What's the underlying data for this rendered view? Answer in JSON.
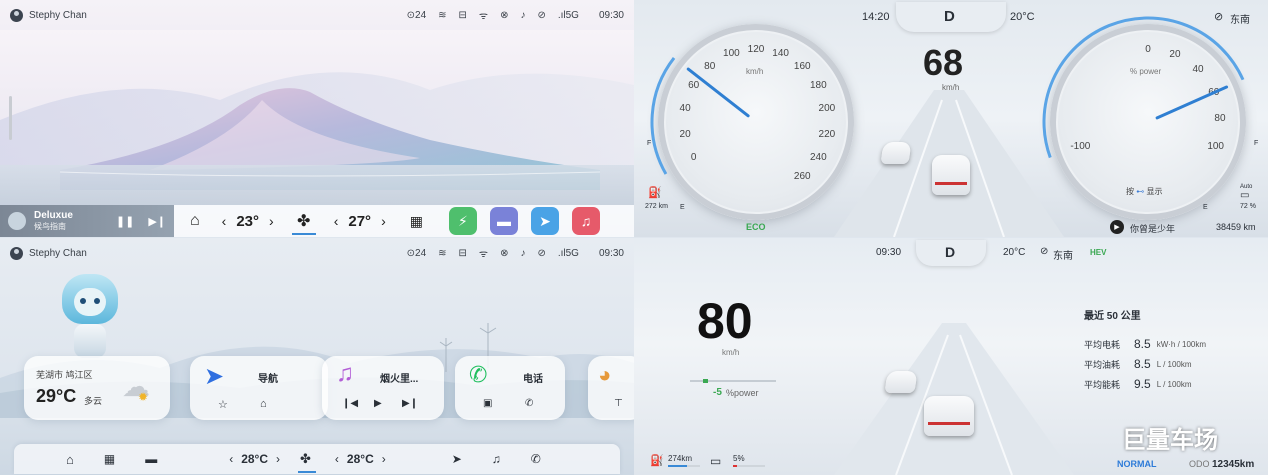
{
  "q1": {
    "status": {
      "user": "Stephy Chan",
      "temp": "24",
      "signal": "5G",
      "time": "09:30"
    },
    "media": {
      "title": "Deluxue",
      "artist": "候鸟指南"
    },
    "climate": {
      "left_temp": "23°",
      "right_temp": "27°"
    },
    "apps": [
      "power-app",
      "car-app",
      "nav-app",
      "music-app"
    ]
  },
  "q2": {
    "time": "14:20",
    "gear": "D",
    "outside_temp": "20°C",
    "direction": "东南",
    "speed": "68",
    "speed_unit": "km/h",
    "speed_ticks": [
      "0",
      "20",
      "40",
      "60",
      "80",
      "100",
      "120",
      "140",
      "160",
      "180",
      "200",
      "220",
      "240",
      "260"
    ],
    "speed_value": 68,
    "power_ticks": [
      "-100",
      "0",
      "20",
      "40",
      "60",
      "80",
      "100"
    ],
    "power_unit": "% power",
    "power_value": 60,
    "fuel_f": "F",
    "fuel_e": "E",
    "range": "272 km",
    "battery_f": "F",
    "battery_e": "E",
    "battery_auto": "Auto",
    "battery_pct": "72 %",
    "mode": "ECO",
    "hint_prefix": "按",
    "hint_suffix": "显示",
    "song": "你曾是少年",
    "odo": "38459 km"
  },
  "q3": {
    "status": {
      "user": "Stephy Chan",
      "temp": "24",
      "signal": "5G",
      "time": "09:30"
    },
    "weather": {
      "location": "芜湖市 鸠江区",
      "temp": "29°C",
      "condition": "多云"
    },
    "cards": [
      {
        "title": "导航"
      },
      {
        "title": "烟火里..."
      },
      {
        "title": "电话"
      }
    ],
    "climate": {
      "left_temp": "28°C",
      "right_temp": "28°C"
    }
  },
  "q4": {
    "time": "09:30",
    "gear": "D",
    "outside_temp": "20°C",
    "direction": "东南",
    "mode_badge": "HEV",
    "speed": "80",
    "speed_unit": "km/h",
    "power": "-5",
    "power_unit": "%power",
    "power_value": -5,
    "trip_title": "最近 50 公里",
    "stats": [
      {
        "label": "平均电耗",
        "value": "8.5",
        "unit": "kW·h / 100km"
      },
      {
        "label": "平均油耗",
        "value": "8.5",
        "unit": "L / 100km"
      },
      {
        "label": "平均能耗",
        "value": "9.5",
        "unit": "L / 100km"
      }
    ],
    "fuel_range": "274km",
    "battery": "5%",
    "drive_mode": "NORMAL",
    "odo_label": "ODO",
    "odo": "12345km",
    "watermark": "巨量车场"
  }
}
